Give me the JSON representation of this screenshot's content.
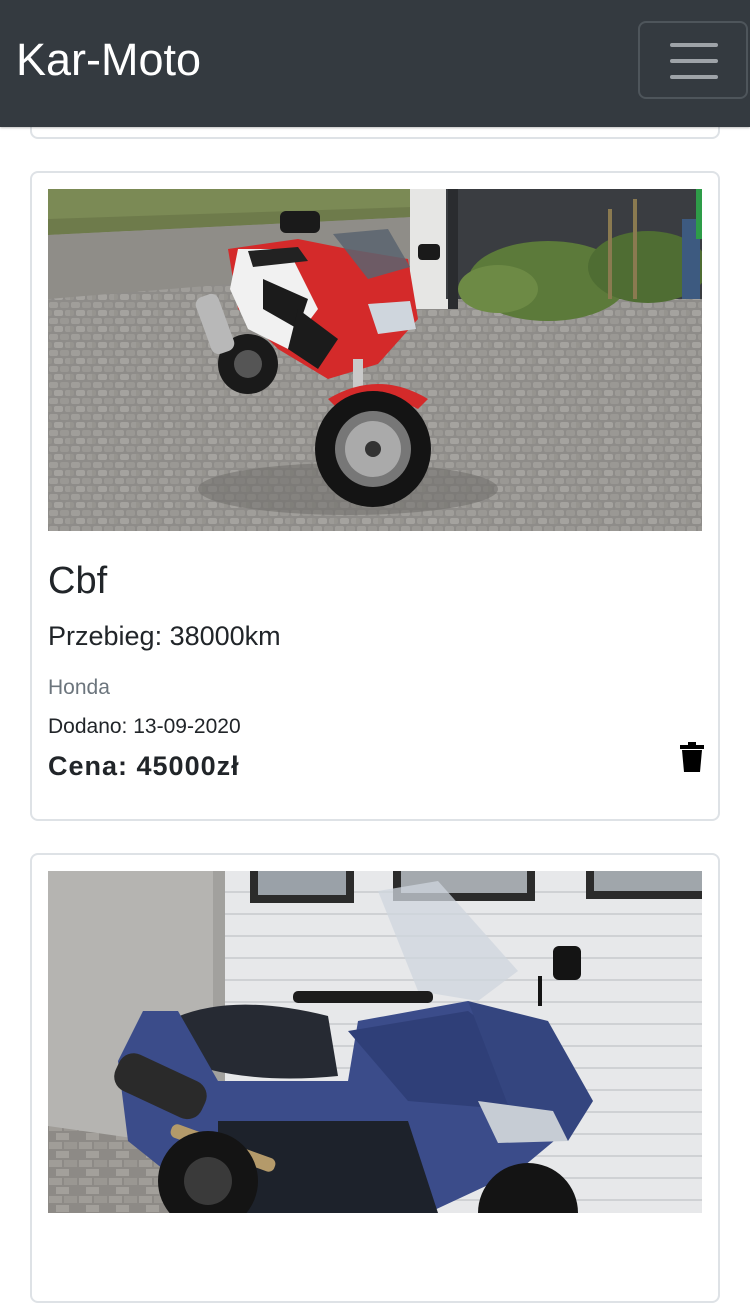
{
  "navbar": {
    "brand": "Kar-Moto",
    "toggler_icon": "hamburger-menu-icon"
  },
  "listings": [
    {
      "title": "Cbf",
      "mileage": "Przebieg: 38000km",
      "brand": "Honda",
      "added": "Dodano: 13-09-2020",
      "price": "Cena: 45000zł",
      "photo_subject": "red-white sport motorcycle",
      "delete_icon": "trash-icon"
    },
    {
      "photo_subject": "blue maxi scooter"
    }
  ],
  "colors": {
    "navbar_bg": "#343a40",
    "card_border": "#dee2e6",
    "muted_text": "#6c757d"
  }
}
